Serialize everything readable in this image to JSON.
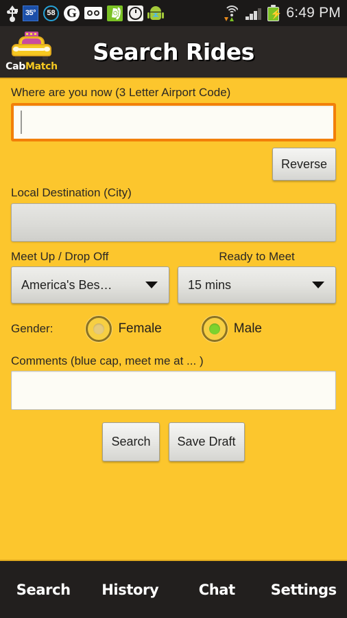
{
  "statusbar": {
    "icons": [
      {
        "name": "usb-icon",
        "label": ""
      },
      {
        "name": "weather-temp-icon",
        "label": "35°"
      },
      {
        "name": "notification-count-icon",
        "label": "58"
      },
      {
        "name": "google-icon",
        "label": "G"
      },
      {
        "name": "voicemail-icon",
        "label": ""
      },
      {
        "name": "phone-icon",
        "label": ""
      },
      {
        "name": "alarm-clock-icon",
        "label": ""
      },
      {
        "name": "android-icon",
        "label": ""
      }
    ],
    "temperature": "35°",
    "badge_count": "58",
    "google_glyph": "G",
    "clock": "6:49 PM"
  },
  "header": {
    "title": "Search Rides",
    "logo_cab": "Cab",
    "logo_match": "Match"
  },
  "form": {
    "origin_label": "Where are you now (3 Letter Airport Code)",
    "origin_value": "",
    "origin_placeholder": "",
    "reverse_label": "Reverse",
    "destination_label": "Local Destination (City)",
    "destination_value": "",
    "destination_placeholder": "",
    "meetup_label": "Meet Up / Drop Off",
    "meetup_value": "America's Bes…",
    "ready_label": "Ready to Meet",
    "ready_value": "15 mins",
    "gender_label": "Gender:",
    "gender_female": "Female",
    "gender_male": "Male",
    "comments_label": "Comments (blue cap, meet me at ... )",
    "comments_value": "",
    "comments_placeholder": "",
    "search_label": "Search",
    "save_draft_label": "Save Draft"
  },
  "bottomnav": {
    "items": [
      {
        "label": "Search"
      },
      {
        "label": "History"
      },
      {
        "label": "Chat"
      },
      {
        "label": "Settings"
      }
    ]
  },
  "colors": {
    "brand_yellow": "#FCC62D",
    "header_dark": "#2B2725",
    "accent_gold": "#E0A91E",
    "focus_orange": "#F28009",
    "radio_selected_green": "#7CD22E",
    "taxi_sign_pink": "#C94B9E"
  }
}
